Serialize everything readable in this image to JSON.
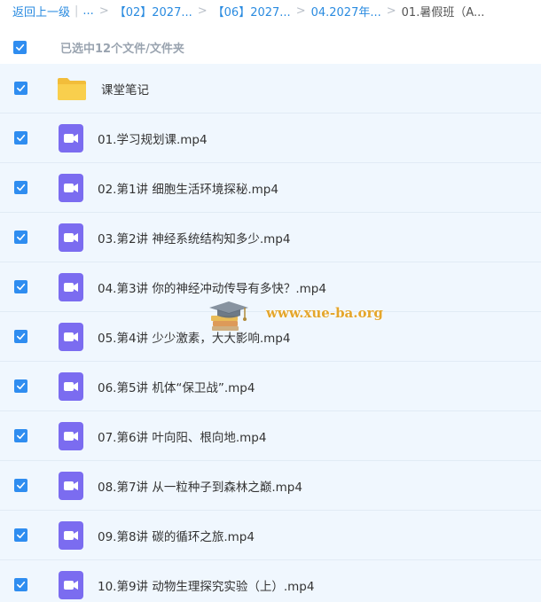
{
  "breadcrumb": {
    "back": "返回上一级",
    "ellipsis": "...",
    "items": [
      "【02】2027...",
      "【06】2027...",
      "04.2027年...",
      "01.暑假班（A..."
    ]
  },
  "selection": {
    "label": "已选中12个文件/文件夹",
    "checked": true
  },
  "files": [
    {
      "name": "课堂笔记",
      "type": "folder",
      "checked": true
    },
    {
      "name": "01.学习规划课.mp4",
      "type": "video",
      "checked": true
    },
    {
      "name": "02.第1讲 细胞生活环境探秘.mp4",
      "type": "video",
      "checked": true
    },
    {
      "name": "03.第2讲 神经系统结构知多少.mp4",
      "type": "video",
      "checked": true
    },
    {
      "name": "04.第3讲 你的神经冲动传导有多快？.mp4",
      "type": "video",
      "checked": true
    },
    {
      "name": "05.第4讲 少少激素，大大影响.mp4",
      "type": "video",
      "checked": true
    },
    {
      "name": "06.第5讲 机体“保卫战”.mp4",
      "type": "video",
      "checked": true
    },
    {
      "name": "07.第6讲 叶向阳、根向地.mp4",
      "type": "video",
      "checked": true
    },
    {
      "name": "08.第7讲 从一粒种子到森林之巅.mp4",
      "type": "video",
      "checked": true
    },
    {
      "name": "09.第8讲 碳的循环之旅.mp4",
      "type": "video",
      "checked": true
    },
    {
      "name": "10.第9讲 动物生理探究实验（上）.mp4",
      "type": "video",
      "checked": true
    }
  ],
  "watermark": {
    "text": "www.xue-ba.org"
  },
  "colors": {
    "accent": "#2f8df0",
    "row_bg": "#f0f7fe",
    "video_icon": "#7b6cf0",
    "folder_icon": "#f7c948"
  }
}
